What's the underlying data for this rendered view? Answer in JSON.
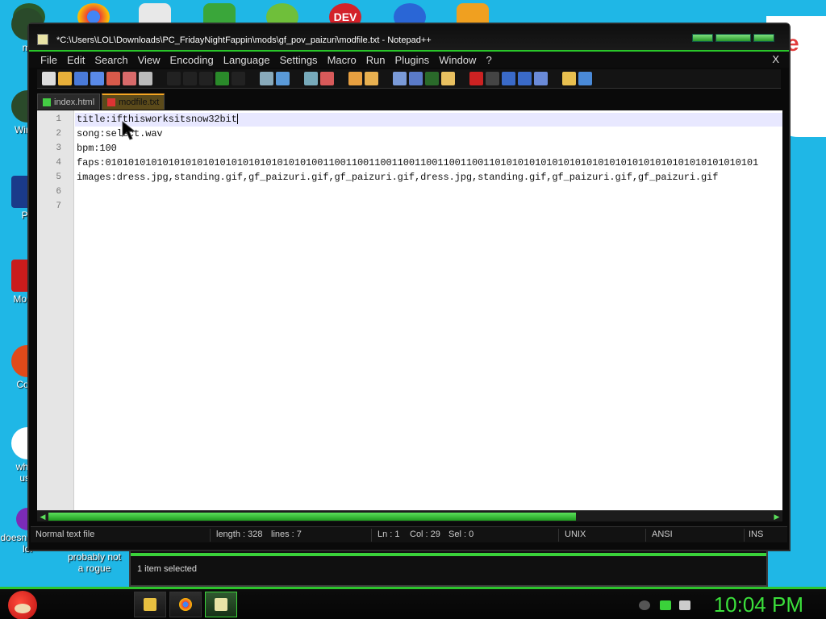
{
  "window": {
    "title": "*C:\\Users\\LOL\\Downloads\\PC_FridayNightFappin\\mods\\gf_pov_paizuri\\modfile.txt - Notepad++",
    "close_label": "X"
  },
  "menu": [
    "File",
    "Edit",
    "Search",
    "View",
    "Encoding",
    "Language",
    "Settings",
    "Macro",
    "Run",
    "Plugins",
    "Window",
    "?"
  ],
  "tabs": [
    {
      "label": "index.html",
      "active": false
    },
    {
      "label": "modfile.txt",
      "active": true
    }
  ],
  "editor": {
    "lines": [
      {
        "num": "1",
        "text": "title:ifthisworksitsnow32bit"
      },
      {
        "num": "2",
        "text": "song:select.wav"
      },
      {
        "num": "3",
        "text": "bpm:100"
      },
      {
        "num": "4",
        "text": "faps:010101010101010101010101010101010101001100110011001100110011001100110101010101010101010101010101010101010101010101"
      },
      {
        "num": "5",
        "text": "images:dress.jpg,standing.gif,gf_paizuri.gif,gf_paizuri.gif,dress.jpg,standing.gif,gf_paizuri.gif,gf_paizuri.gif"
      },
      {
        "num": "6",
        "text": ""
      },
      {
        "num": "7",
        "text": ""
      }
    ]
  },
  "status": {
    "type": "Normal text file",
    "length": "length : 328",
    "lines": "lines : 7",
    "ln": "Ln : 1",
    "col": "Col : 29",
    "sel": "Sel : 0",
    "eol": "UNIX",
    "encoding": "ANSI",
    "mode": "INS"
  },
  "desktop": {
    "icons": [
      "mi",
      "Win V",
      "Po",
      "Mo Re",
      "Cock",
      "who t use",
      "doesn't work lol",
      "probably not a rogue"
    ],
    "dev_icon": "DEV",
    "paper_text": "e",
    "bg_explorer_status": "1 item selected"
  },
  "taskbar": {
    "clock": "10:04 PM"
  },
  "colors": {
    "accent": "#2dc52d",
    "desktop": "#1fb7e6"
  }
}
